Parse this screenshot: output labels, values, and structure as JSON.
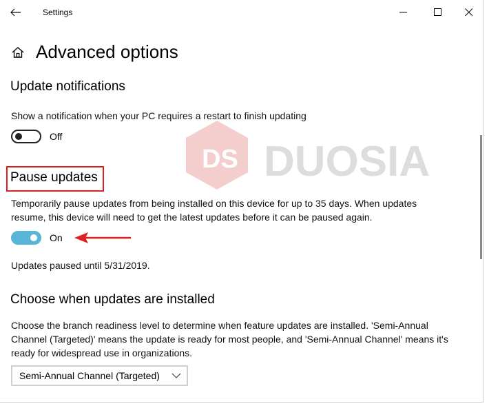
{
  "window": {
    "title": "Settings"
  },
  "page": {
    "title": "Advanced options"
  },
  "notifications": {
    "heading": "Update notifications",
    "description": "Show a notification when your PC requires a restart to finish updating",
    "toggle_state": "Off"
  },
  "pause": {
    "heading": "Pause updates",
    "description_line1": "Temporarily pause updates from being installed on this device for up to 35 days. When updates",
    "description_line2": "resume, this device will need to get the latest updates before it can be paused again.",
    "toggle_state": "On",
    "status": "Updates paused until 5/31/2019."
  },
  "branch": {
    "heading": "Choose when updates are installed",
    "description_line1": "Choose the branch readiness level to determine when feature updates are installed. 'Semi-Annual",
    "description_line2": "Channel (Targeted)' means the update is ready for most people, and 'Semi-Annual Channel' means it's",
    "description_line3": "ready for widespread use in organizations.",
    "selected": "Semi-Annual Channel (Targeted)"
  },
  "watermark": {
    "logo_text": "DS",
    "brand": "DUOSIA"
  },
  "colors": {
    "toggle_on": "#58b5d8",
    "highlight": "#e02020",
    "watermark": "#d9534f"
  },
  "icons": [
    "back-arrow-icon",
    "minimize-icon",
    "maximize-icon",
    "close-icon",
    "home-icon",
    "chevron-down-icon",
    "red-arrow-icon"
  ]
}
